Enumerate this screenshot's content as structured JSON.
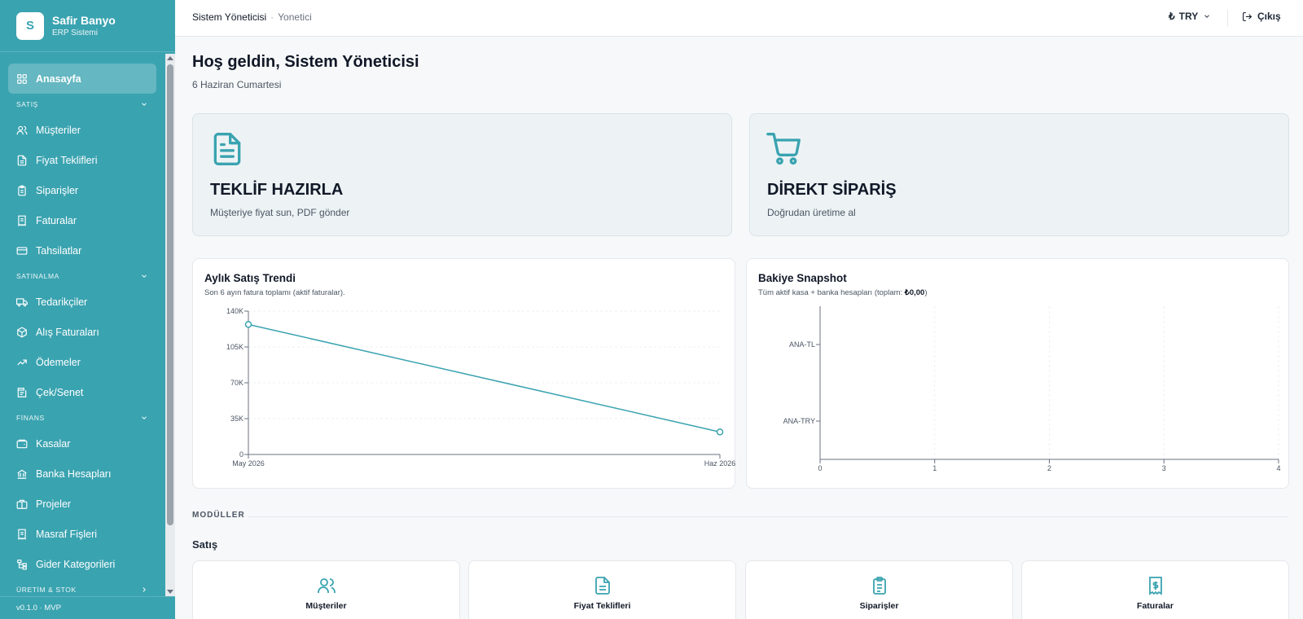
{
  "brand": {
    "logo_letter": "S",
    "name": "Safir Banyo",
    "subtitle": "ERP Sistemi"
  },
  "sidebar": {
    "home": {
      "label": "Anasayfa",
      "icon": "grid-icon"
    },
    "sections": [
      {
        "title": "SATIŞ",
        "items": [
          {
            "label": "Müşteriler",
            "icon": "users-icon"
          },
          {
            "label": "Fiyat Teklifleri",
            "icon": "file-text-icon"
          },
          {
            "label": "Siparişler",
            "icon": "clipboard-icon"
          },
          {
            "label": "Faturalar",
            "icon": "receipt-icon"
          },
          {
            "label": "Tahsilatlar",
            "icon": "credit-card-icon"
          }
        ]
      },
      {
        "title": "SATINALMA",
        "items": [
          {
            "label": "Tedarikçiler",
            "icon": "truck-icon"
          },
          {
            "label": "Alış Faturaları",
            "icon": "package-icon"
          },
          {
            "label": "Ödemeler",
            "icon": "banknote-icon"
          },
          {
            "label": "Çek/Senet",
            "icon": "ticket-icon"
          }
        ]
      },
      {
        "title": "FİNANS",
        "items": [
          {
            "label": "Kasalar",
            "icon": "wallet-icon"
          },
          {
            "label": "Banka Hesapları",
            "icon": "bank-icon"
          },
          {
            "label": "Projeler",
            "icon": "briefcase-icon"
          },
          {
            "label": "Masraf Fişleri",
            "icon": "receipt-icon"
          },
          {
            "label": "Gider Kategorileri",
            "icon": "tree-icon"
          }
        ]
      },
      {
        "title": "ÜRETİM & STOK",
        "items": []
      }
    ],
    "version": "v0.1.0 · MVP"
  },
  "header": {
    "user": "Sistem Yöneticisi",
    "separator": "·",
    "role": "Yonetici",
    "currency": "TRY",
    "currency_symbol": "₺",
    "logout_label": "Çıkış"
  },
  "main": {
    "welcome": "Hoş geldin, Sistem Yöneticisi",
    "date": "6 Haziran Cumartesi",
    "actions": [
      {
        "title": "TEKLİF HAZIRLA",
        "subtitle": "Müşteriye fiyat sun, PDF gönder",
        "icon": "file-text-icon"
      },
      {
        "title": "DİREKT SİPARİŞ",
        "subtitle": "Doğrudan üretime al",
        "icon": "shopping-cart-icon"
      }
    ],
    "sales_panel": {
      "title": "Aylık Satış Trendi",
      "subtitle": "Son 6 ayın fatura toplamı (aktif faturalar)."
    },
    "balance_panel": {
      "title": "Bakiye Snapshot",
      "subtitle_prefix": "Tüm aktif kasa + banka hesapları (toplam: ",
      "subtitle_total": "₺0,00",
      "subtitle_suffix": ")"
    },
    "modules_label": "MODÜLLER",
    "group_label": "Satış",
    "modules": [
      {
        "label": "Müşteriler",
        "icon": "users-icon"
      },
      {
        "label": "Fiyat Teklifleri",
        "icon": "file-text-icon"
      },
      {
        "label": "Siparişler",
        "icon": "clipboard-icon"
      },
      {
        "label": "Faturalar",
        "icon": "receipt-dollar-icon"
      }
    ]
  },
  "colors": {
    "accent": "#3aa3b0",
    "line": "#3aa3b0"
  },
  "chart_data": [
    {
      "type": "line",
      "title": "Aylık Satış Trendi",
      "x": [
        "May 2026",
        "Haz 2026"
      ],
      "series": [
        {
          "values": [
            127000,
            22000
          ]
        }
      ],
      "ylim": [
        0,
        140000
      ],
      "yticks": [
        0,
        35000,
        70000,
        105000,
        140000
      ],
      "ytick_labels": [
        "0",
        "35K",
        "70K",
        "105K",
        "140K"
      ],
      "grid": true
    },
    {
      "type": "bar",
      "orientation": "horizontal",
      "title": "Bakiye Snapshot",
      "categories": [
        "ANA-TL",
        "ANA-TRY"
      ],
      "values": [
        0,
        0
      ],
      "xlim": [
        0,
        4
      ],
      "xticks": [
        "0",
        "1",
        "2",
        "3",
        "4"
      ],
      "grid": true
    }
  ]
}
